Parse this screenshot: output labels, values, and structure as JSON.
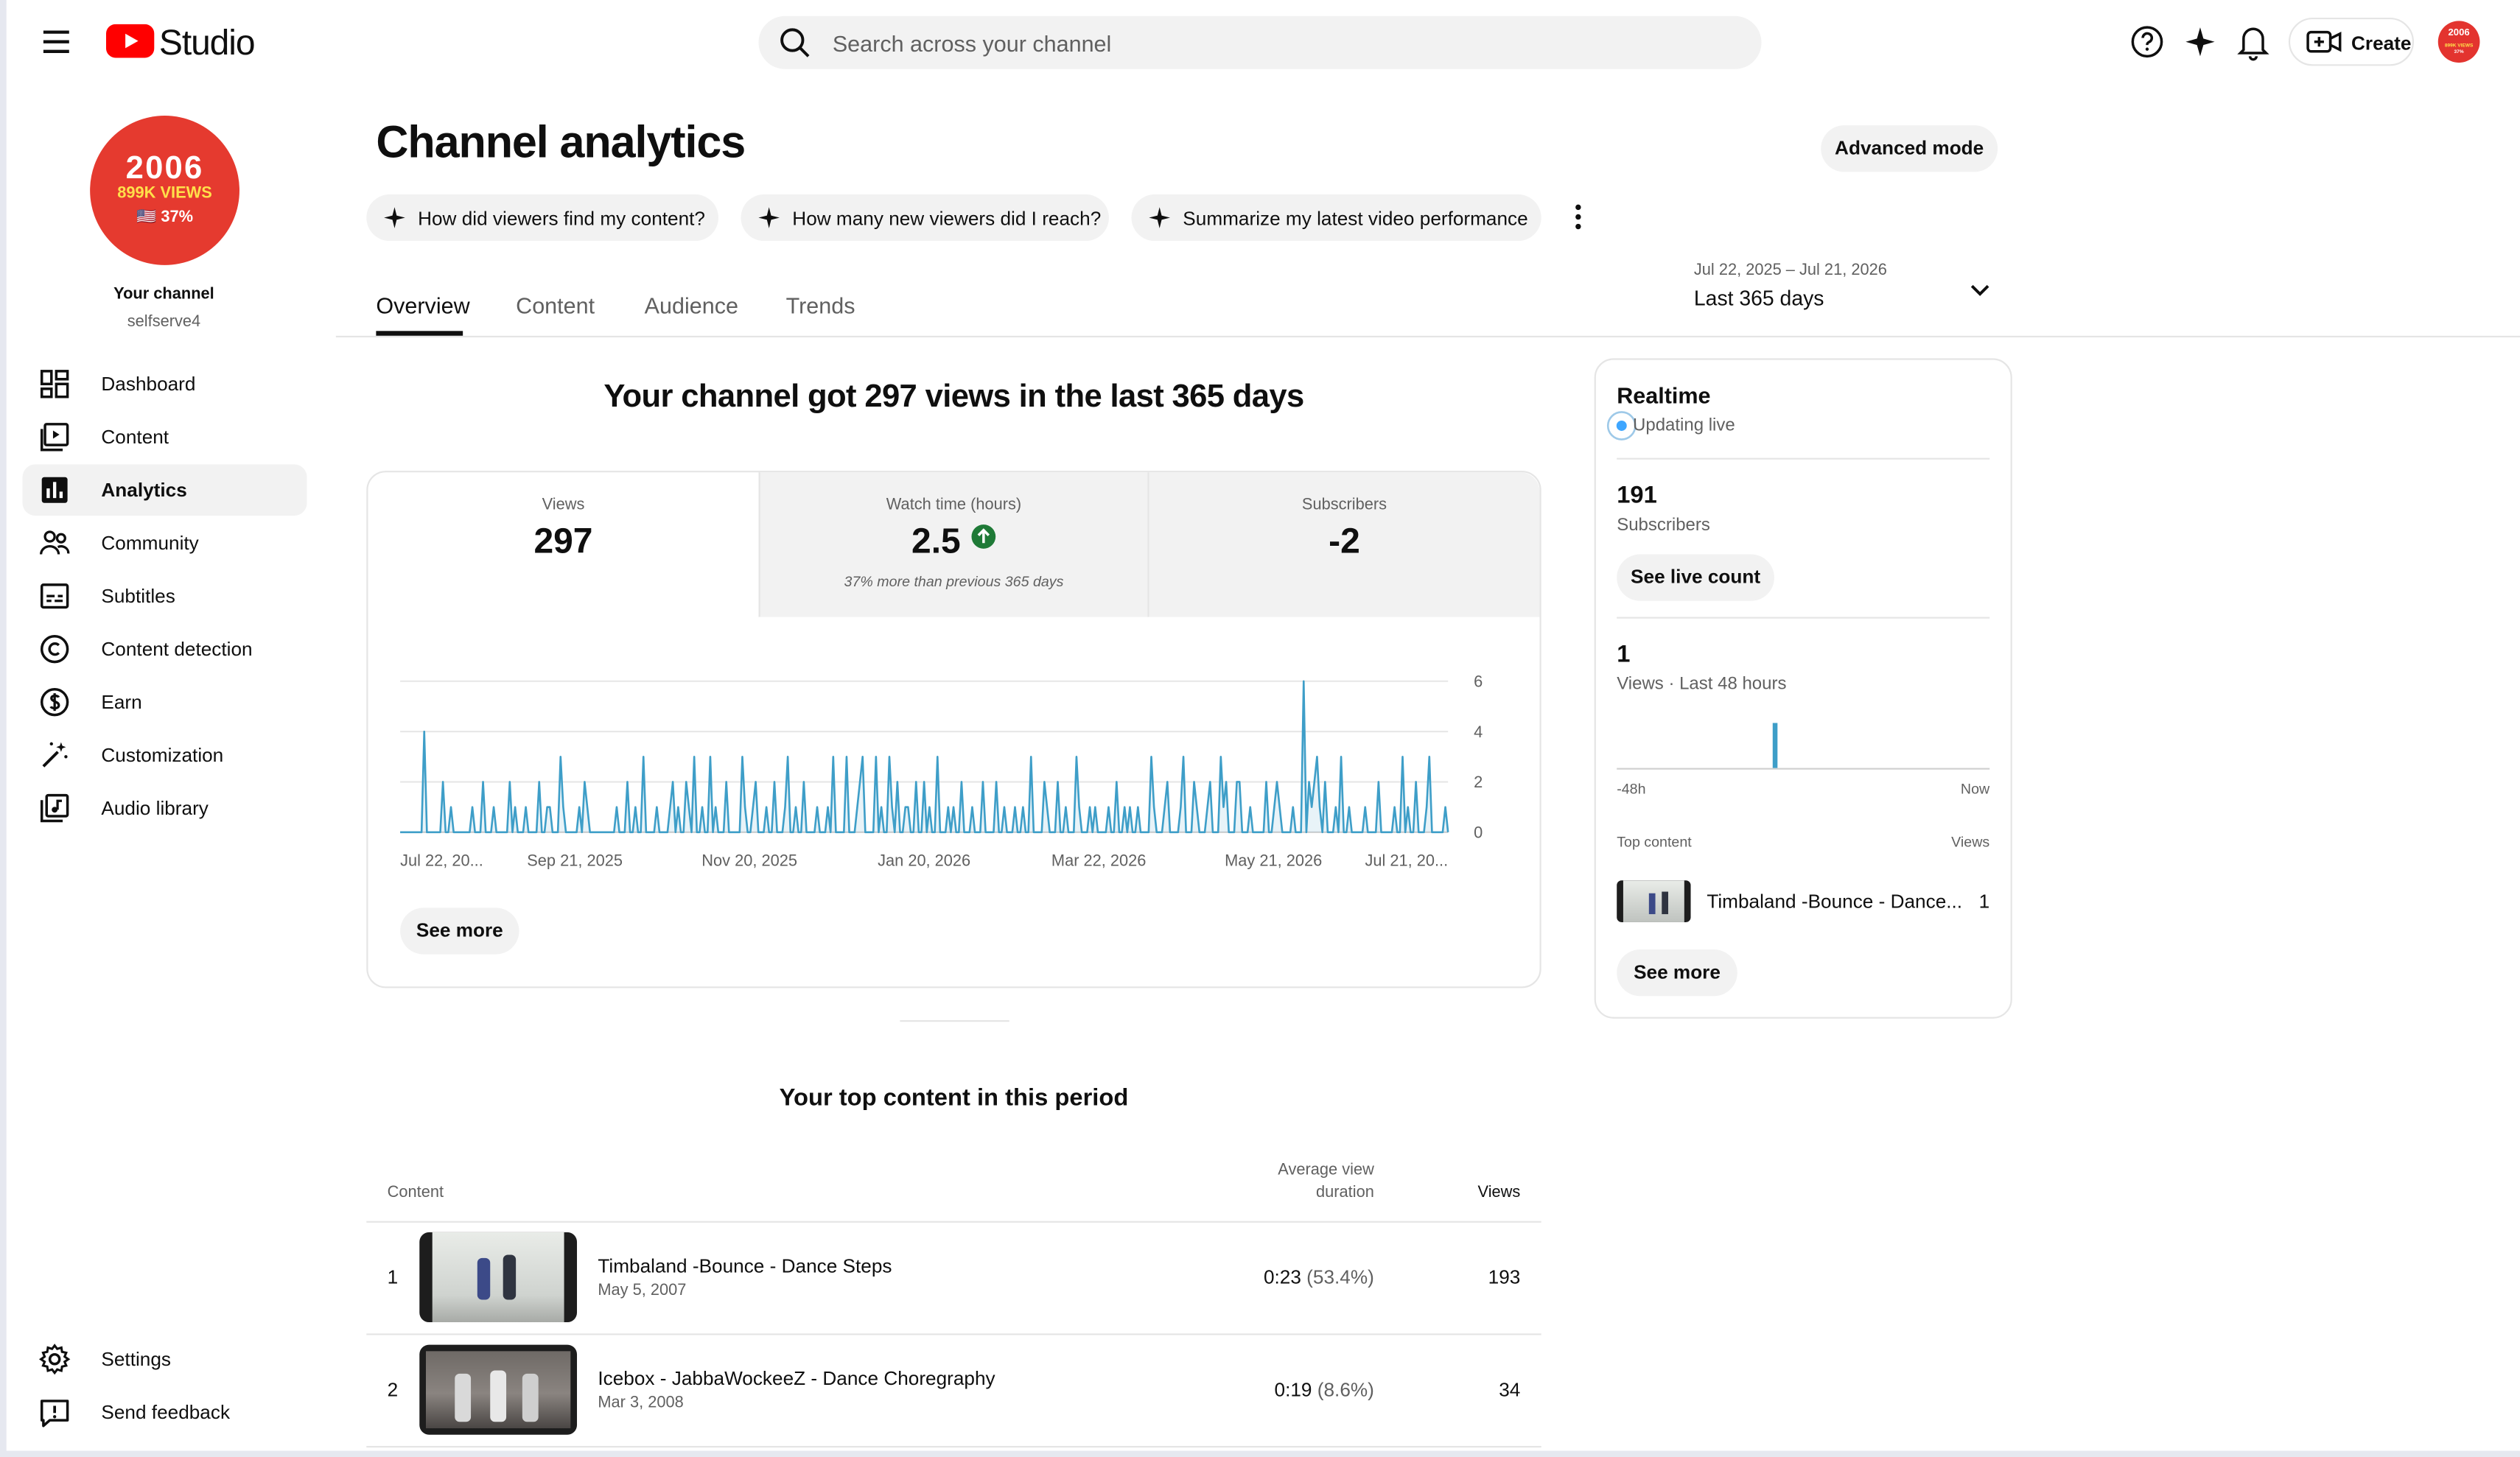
{
  "app": {
    "name": "Studio"
  },
  "search": {
    "placeholder": "Search across your channel"
  },
  "topbar": {
    "create_label": "Create",
    "avatar_lines": [
      "2006",
      "899K VIEWS",
      "37%"
    ]
  },
  "channel": {
    "avatar_line1": "2006",
    "avatar_line2": "899K VIEWS",
    "avatar_line3": "🇺🇸 37%",
    "title": "Your channel",
    "handle": "selfserve4"
  },
  "sidebar": {
    "items": [
      {
        "label": "Dashboard",
        "icon": "dashboard-icon"
      },
      {
        "label": "Content",
        "icon": "content-icon"
      },
      {
        "label": "Analytics",
        "icon": "analytics-icon",
        "active": true
      },
      {
        "label": "Community",
        "icon": "community-icon"
      },
      {
        "label": "Subtitles",
        "icon": "subtitles-icon"
      },
      {
        "label": "Content detection",
        "icon": "copyright-icon"
      },
      {
        "label": "Earn",
        "icon": "dollar-icon"
      },
      {
        "label": "Customization",
        "icon": "magic-wand-icon"
      },
      {
        "label": "Audio library",
        "icon": "audio-library-icon"
      }
    ],
    "footer": [
      {
        "label": "Settings",
        "icon": "gear-icon"
      },
      {
        "label": "Send feedback",
        "icon": "feedback-icon"
      }
    ]
  },
  "page": {
    "title": "Channel analytics",
    "advanced_mode": "Advanced mode",
    "chips": [
      "How did viewers find my content?",
      "How many new viewers did I reach?",
      "Summarize my latest video performance"
    ],
    "tabs": [
      "Overview",
      "Content",
      "Audience",
      "Trends"
    ],
    "active_tab": "Overview",
    "date_range": {
      "dates": "Jul 22, 2025 – Jul 21, 2026",
      "label": "Last 365 days"
    }
  },
  "overview": {
    "headline": "Your channel got 297 views in the last 365 days",
    "metrics": [
      {
        "title": "Views",
        "value": "297"
      },
      {
        "title": "Watch time (hours)",
        "value": "2.5",
        "note": "37% more than previous 365 days"
      },
      {
        "title": "Subscribers",
        "value": "-2"
      }
    ],
    "see_more": "See more"
  },
  "chart_data": {
    "type": "line",
    "series_color": "#3e9ec8",
    "y_ticks": [
      0,
      2,
      4,
      6
    ],
    "ylim": [
      0,
      6
    ],
    "x_tick_labels": [
      "Jul 22, 20...",
      "Sep 21, 2025",
      "Nov 20, 2025",
      "Jan 20, 2026",
      "Mar 22, 2026",
      "May 21, 2026",
      "Jul 21, 20..."
    ],
    "values": [
      0,
      0,
      0,
      0,
      0,
      0,
      0,
      0,
      0,
      4,
      0,
      0,
      0,
      0,
      0,
      0,
      2,
      0,
      0,
      1,
      0,
      0,
      0,
      0,
      0,
      0,
      0,
      1,
      0,
      0,
      0,
      2,
      0,
      0,
      0,
      1,
      0,
      0,
      0,
      0,
      0,
      2,
      0,
      1,
      0,
      0,
      0,
      1,
      0,
      0,
      0,
      0,
      2,
      0,
      0,
      1,
      1,
      0,
      0,
      0,
      3,
      1,
      0,
      0,
      0,
      0,
      0,
      1,
      0,
      2,
      1,
      0,
      0,
      0,
      0,
      0,
      0,
      0,
      0,
      0,
      0,
      1,
      0,
      0,
      0,
      2,
      0,
      0,
      1,
      0,
      0,
      3,
      0,
      0,
      0,
      0,
      1,
      0,
      0,
      0,
      0,
      1,
      2,
      0,
      1,
      0,
      0,
      2,
      1,
      0,
      3,
      0,
      0,
      1,
      0,
      0,
      3,
      0,
      1,
      0,
      0,
      0,
      2,
      0,
      0,
      0,
      0,
      0,
      3,
      1,
      0,
      0,
      1,
      2,
      0,
      0,
      0,
      1,
      0,
      0,
      2,
      0,
      0,
      0,
      1,
      3,
      0,
      0,
      1,
      0,
      0,
      2,
      0,
      0,
      0,
      0,
      1,
      0,
      0,
      0,
      1,
      0,
      3,
      0,
      0,
      0,
      0,
      3,
      0,
      0,
      0,
      1,
      2,
      3,
      0,
      0,
      0,
      0,
      3,
      0,
      1,
      0,
      0,
      3,
      1,
      0,
      2,
      0,
      0,
      1,
      1,
      0,
      0,
      2,
      0,
      0,
      2,
      0,
      1,
      0,
      0,
      3,
      0,
      0,
      0,
      1,
      0,
      1,
      0,
      0,
      2,
      0,
      0,
      0,
      1,
      0,
      0,
      0,
      2,
      0,
      0,
      0,
      0,
      2,
      0,
      0,
      1,
      0,
      0,
      0,
      1,
      0,
      0,
      1,
      0,
      0,
      3,
      0,
      0,
      0,
      0,
      2,
      1,
      0,
      0,
      0,
      2,
      0,
      0,
      1,
      0,
      0,
      0,
      3,
      1,
      0,
      0,
      0,
      1,
      0,
      1,
      0,
      0,
      0,
      0,
      1,
      0,
      0,
      2,
      0,
      0,
      1,
      0,
      1,
      0,
      0,
      1,
      0,
      0,
      0,
      0,
      3,
      1,
      0,
      0,
      0,
      1,
      2,
      0,
      0,
      0,
      0,
      1,
      3,
      0,
      0,
      0,
      2,
      1,
      0,
      0,
      0,
      1,
      2,
      0,
      0,
      0,
      3,
      1,
      2,
      0,
      0,
      0,
      2,
      2,
      0,
      0,
      0,
      1,
      0,
      0,
      0,
      0,
      0,
      2,
      0,
      0,
      1,
      2,
      1,
      0,
      0,
      0,
      0,
      1,
      0,
      0,
      0,
      6,
      0,
      2,
      1,
      2,
      3,
      1,
      0,
      2,
      0,
      0,
      0,
      1,
      0,
      3,
      0,
      0,
      1,
      0,
      0,
      0,
      0,
      0,
      1,
      0,
      0,
      0,
      0,
      2,
      0,
      0,
      0,
      0,
      0,
      1,
      0,
      0,
      3,
      0,
      1,
      0,
      0,
      2,
      0,
      0,
      0,
      1,
      3,
      0,
      0,
      0,
      0,
      0,
      1,
      0
    ]
  },
  "realtime": {
    "title": "Realtime",
    "status": "Updating live",
    "subscribers_value": "191",
    "subscribers_label": "Subscribers",
    "see_live_count": "See live count",
    "views_value": "1",
    "views_label": "Views · Last 48 hours",
    "axis_start": "-48h",
    "axis_end": "Now",
    "bar_position": 0.42,
    "top_content_label": "Top content",
    "views_col_label": "Views",
    "top_item_title": "Timbaland -Bounce - Dance...",
    "top_item_views": "1",
    "see_more": "See more"
  },
  "top_content": {
    "title": "Your top content in this period",
    "columns": {
      "content": "Content",
      "avd_line1": "Average view",
      "avd_line2": "duration",
      "views": "Views"
    },
    "rows": [
      {
        "rank": "1",
        "title": "Timbaland -Bounce - Dance Steps",
        "date": "May 5, 2007",
        "avd": "0:23",
        "avd_pct": "(53.4%)",
        "views": "193"
      },
      {
        "rank": "2",
        "title": "Icebox - JabbaWockeeZ - Dance Choregraphy",
        "date": "Mar 3, 2008",
        "avd": "0:19",
        "avd_pct": "(8.6%)",
        "views": "34"
      }
    ]
  }
}
